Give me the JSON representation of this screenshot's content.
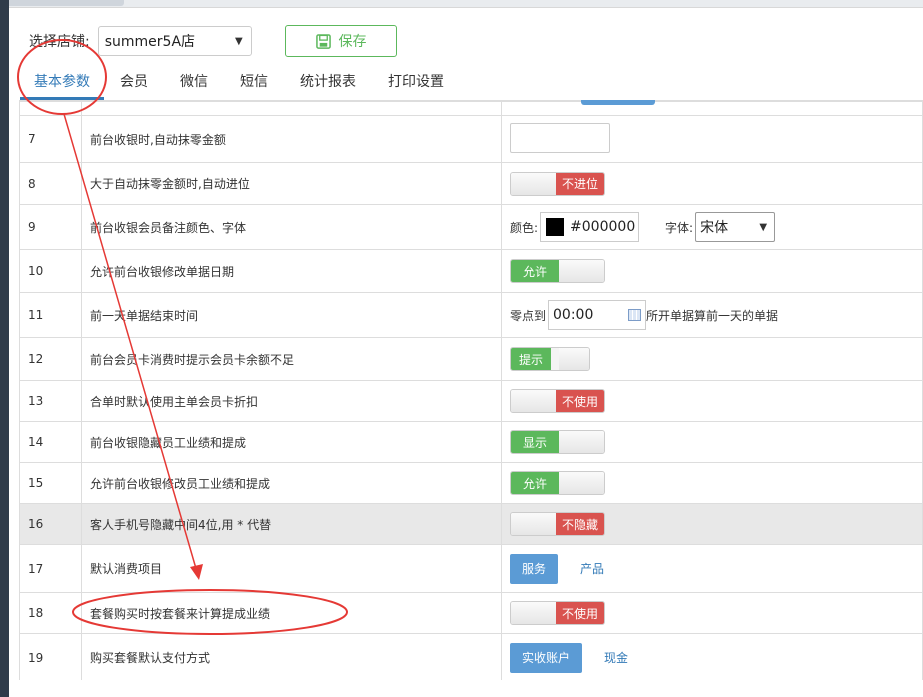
{
  "header": {
    "store_label": "选择店铺:",
    "store_value": "summer5A店",
    "save_label": "保存"
  },
  "tabs": [
    {
      "label": "基本参数",
      "active": true
    },
    {
      "label": "会员"
    },
    {
      "label": "微信"
    },
    {
      "label": "短信"
    },
    {
      "label": "统计报表"
    },
    {
      "label": "打印设置"
    }
  ],
  "rows": [
    {
      "num": "7",
      "desc": "前台收银时,自动抹零金额"
    },
    {
      "num": "8",
      "desc": "大于自动抹零金额时,自动进位",
      "toggle": "不进位"
    },
    {
      "num": "9",
      "desc": "前台收银会员备注颜色、字体",
      "color_label": "颜色:",
      "color_value": "#000000",
      "font_label": "字体:",
      "font_value": "宋体"
    },
    {
      "num": "10",
      "desc": "允许前台收银修改单据日期",
      "toggle": "允许"
    },
    {
      "num": "11",
      "desc": "前一天单据结束时间",
      "prefix": "零点到",
      "time_value": "00:00",
      "suffix": "所开单据算前一天的单据"
    },
    {
      "num": "12",
      "desc": "前台会员卡消费时提示会员卡余额不足",
      "toggle": "提示"
    },
    {
      "num": "13",
      "desc": "合单时默认使用主单会员卡折扣",
      "toggle": "不使用"
    },
    {
      "num": "14",
      "desc": "前台收银隐藏员工业绩和提成",
      "toggle": "显示"
    },
    {
      "num": "15",
      "desc": "允许前台收银修改员工业绩和提成",
      "toggle": "允许"
    },
    {
      "num": "16",
      "desc": "客人手机号隐藏中间4位,用 * 代替",
      "toggle": "不隐藏"
    },
    {
      "num": "17",
      "desc": "默认消费项目",
      "btn": "服务",
      "link": "产品"
    },
    {
      "num": "18",
      "desc": "套餐购买时按套餐来计算提成业绩",
      "toggle": "不使用"
    },
    {
      "num": "19",
      "desc": "购买套餐默认支付方式",
      "btn": "实收账户",
      "link": "现金"
    }
  ],
  "colors": {
    "accent": "#337ab7",
    "success": "#5cb85c",
    "danger": "#d9534f",
    "button_blue": "#5b9bd5",
    "annotation": "#e53935"
  }
}
